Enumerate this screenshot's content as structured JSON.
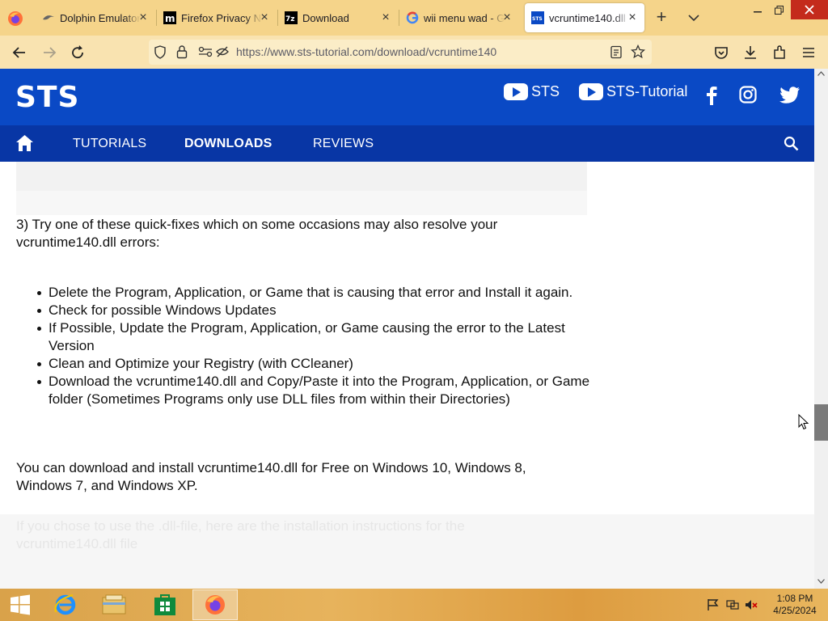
{
  "browser": {
    "tabs": [
      {
        "label": "Dolphin Emulator",
        "favicon": "dolphin-icon",
        "active": false
      },
      {
        "label": "Firefox Privacy No",
        "favicon": "mozilla-m-icon",
        "active": false
      },
      {
        "label": "Download",
        "favicon": "7zip-icon",
        "active": false
      },
      {
        "label": "wii menu wad - G",
        "favicon": "google-icon",
        "active": false
      },
      {
        "label": "vcruntime140.dll",
        "favicon": "sts-icon",
        "active": true
      }
    ],
    "url": "https://www.sts-tutorial.com/download/vcruntime140"
  },
  "site": {
    "logo": "STS",
    "social": {
      "youtube1": "STS",
      "youtube2": "STS-Tutorial"
    },
    "nav": {
      "tutorials": "TUTORIALS",
      "downloads": "DOWNLOADS",
      "reviews": "REVIEWS"
    }
  },
  "article": {
    "step3": "3) Try one of these quick-fixes which on some occasions may also resolve your vcruntime140.dll errors:",
    "fixes": [
      "Delete the Program, Application, or Game that is causing that error and Install it again.",
      "Check for possible Windows Updates",
      "If Possible, Update the Program, Application, or Game causing the error to the Latest Version",
      "Clean and Optimize your Registry (with CCleaner)",
      "Download the vcruntime140.dll and Copy/Paste it into the Program, Application, or Game folder (Sometimes Programs only use DLL files from within their Directories)"
    ],
    "download_note": "You can download and install vcruntime140.dll for Free on Windows 10, Windows 8, Windows 7, and Windows XP.",
    "faded_text": "If you chose to use the .dll-file, here are the installation instructions for the vcruntime140.dll file"
  },
  "taskbar": {
    "time": "1:08 PM",
    "date": "4/25/2024"
  }
}
